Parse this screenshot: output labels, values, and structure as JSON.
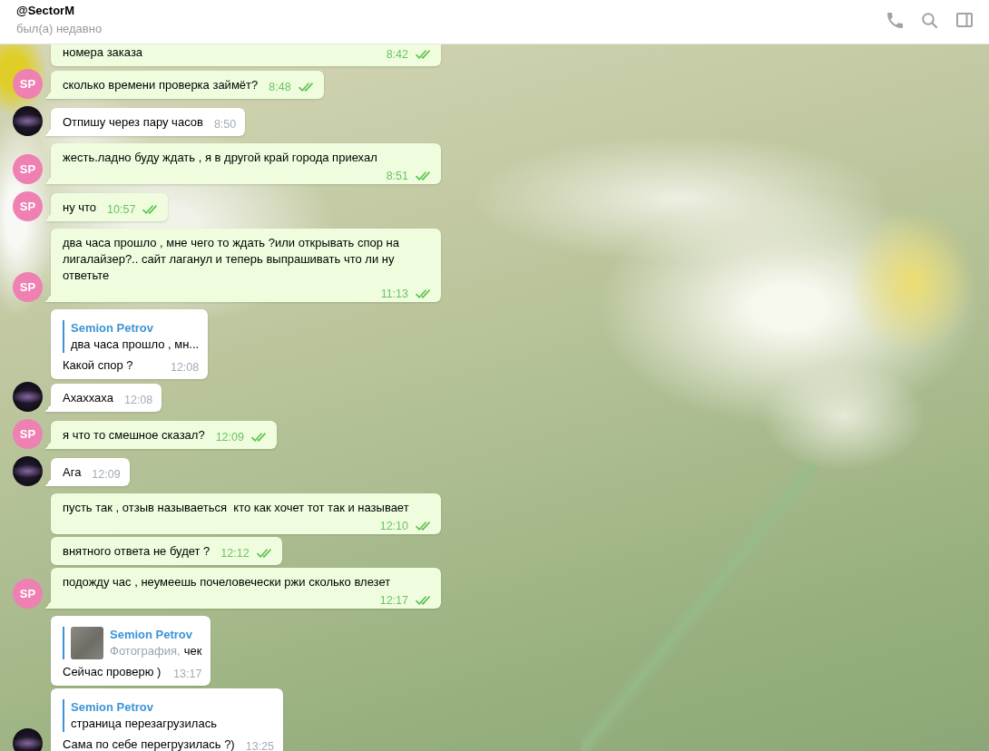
{
  "header": {
    "title": "@SectorM",
    "status": "был(а) недавно"
  },
  "messages": [
    {
      "kind": "outgoing",
      "text": "номера заказа",
      "time": "8:42",
      "read": true
    },
    {
      "kind": "outgoing",
      "avatar": {
        "kind": "initials",
        "initials": "SP"
      },
      "text": "сколько времени проверка займёт?",
      "time": "8:48",
      "read": true
    },
    {
      "kind": "incoming",
      "avatar": {
        "kind": "photo"
      },
      "text": "Отпишу через пару часов",
      "time": "8:50"
    },
    {
      "kind": "outgoing",
      "avatar": {
        "kind": "initials",
        "initials": "SP"
      },
      "text": "жесть.ладно буду ждать , я в другой край города приехал",
      "time": "8:51",
      "read": true
    },
    {
      "kind": "outgoing",
      "avatar": {
        "kind": "initials",
        "initials": "SP"
      },
      "text": "ну что",
      "time": "10:57",
      "read": true
    },
    {
      "kind": "outgoing",
      "avatar": {
        "kind": "initials",
        "initials": "SP"
      },
      "text": "два часа прошло , мне чего то ждать ?или открывать спор на лигалайзер?.. сайт лаганул и теперь выпрашивать что ли ну ответьте",
      "time": "11:13",
      "read": true
    },
    {
      "kind": "incoming",
      "reply": {
        "kind": "text",
        "author": "Semion Petrov",
        "text": "два часа прошло , мн..."
      },
      "text": "Какой спор ?",
      "time": "12:08"
    },
    {
      "kind": "incoming",
      "avatar": {
        "kind": "photo"
      },
      "text": "Ахаххаха",
      "time": "12:08"
    },
    {
      "kind": "outgoing",
      "avatar": {
        "kind": "initials",
        "initials": "SP"
      },
      "text": "я что то смешное сказал?",
      "time": "12:09",
      "read": true
    },
    {
      "kind": "incoming",
      "avatar": {
        "kind": "photo"
      },
      "text": "Ага",
      "time": "12:09"
    },
    {
      "kind": "outgoing",
      "text": "пусть так , отзыв называеться  кто как хочет тот так и называет",
      "time": "12:10",
      "read": true
    },
    {
      "kind": "outgoing",
      "text": "внятного ответа не будет ?",
      "time": "12:12",
      "read": true
    },
    {
      "kind": "outgoing",
      "avatar": {
        "kind": "initials",
        "initials": "SP"
      },
      "text": "подожду час , неумеешь почеловечески ржи сколько влезет",
      "time": "12:17",
      "read": true
    },
    {
      "kind": "incoming",
      "reply": {
        "kind": "photo",
        "author": "Semion Petrov",
        "media": "Фотография,",
        "text": "чек"
      },
      "text": "Сейчас проверю )",
      "time": "13:17"
    },
    {
      "kind": "incoming",
      "avatar": {
        "kind": "photo"
      },
      "reply": {
        "kind": "text",
        "author": "Semion Petrov",
        "text": "страница перезагрузилась"
      },
      "text": "Сама по себе перегрузилась ?)",
      "time": "13:25"
    }
  ]
}
